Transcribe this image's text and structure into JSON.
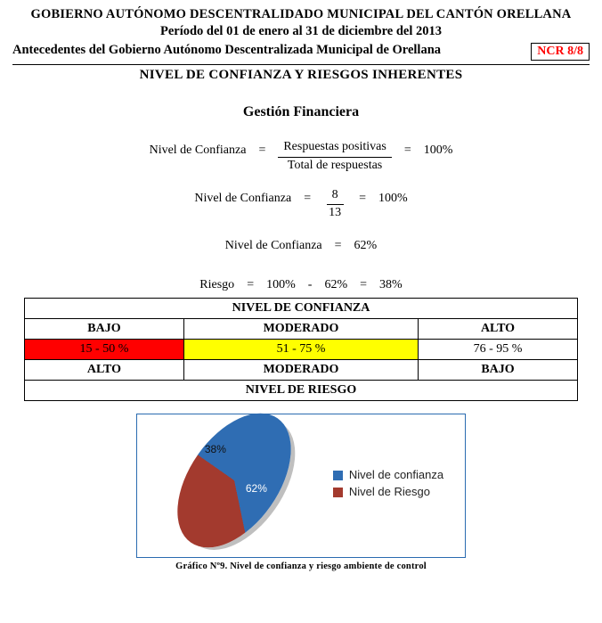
{
  "header": {
    "line1": "GOBIERNO AUTÓNOMO DESCENTRALIDADO MUNICIPAL DEL CANTÓN ORELLANA",
    "line2": "Período del 01 de enero al 31 de diciembre del 2013",
    "line3": "Antecedentes del Gobierno Autónomo Descentralizada Municipal de Orellana",
    "ncr": "NCR 8/8",
    "section": "NIVEL DE CONFIANZA Y RIESGOS INHERENTES"
  },
  "subtitle": "Gestión Financiera",
  "formulas": {
    "f1": {
      "lhs": "Nivel de Confianza",
      "eq": "=",
      "num": "Respuestas positivas",
      "den": "Total de respuestas",
      "eq2": "=",
      "rhs": "100%"
    },
    "f2": {
      "lhs": "Nivel de Confianza",
      "eq": "=",
      "num": "8",
      "den": "13",
      "eq2": "=",
      "rhs": "100%"
    },
    "f3": {
      "lhs": "Nivel de Confianza",
      "eq": "=",
      "rhs": "62%"
    },
    "f4": {
      "lhs": "Riesgo",
      "eq": "=",
      "a": "100%",
      "minus": "-",
      "b": "62%",
      "eq2": "=",
      "rhs": "38%"
    }
  },
  "table": {
    "title_top": "NIVEL DE CONFIANZA",
    "row_labels_top": {
      "c1": "BAJO",
      "c2": "MODERADO",
      "c3": "ALTO"
    },
    "row_ranges": {
      "c1": "15 - 50 %",
      "c2": "51 - 75 %",
      "c3": "76 - 95 %"
    },
    "row_labels_bot": {
      "c1": "ALTO",
      "c2": "MODERADO",
      "c3": "BAJO"
    },
    "title_bot": "NIVEL DE RIESGO"
  },
  "chart_data": {
    "type": "pie",
    "title": "",
    "series": [
      {
        "name": "Nivel de confianza",
        "value": 62,
        "label": "62%",
        "color": "#2f6db3"
      },
      {
        "name": "Nivel de Riesgo",
        "value": 38,
        "label": "38%",
        "color": "#a33a2e"
      }
    ],
    "legend_position": "right"
  },
  "legend": {
    "a": "Nivel de confianza",
    "b": "Nivel de Riesgo"
  },
  "caption_fragment": "Gráfico Nº9. Nivel de confianza y riesgo ambiente de control"
}
